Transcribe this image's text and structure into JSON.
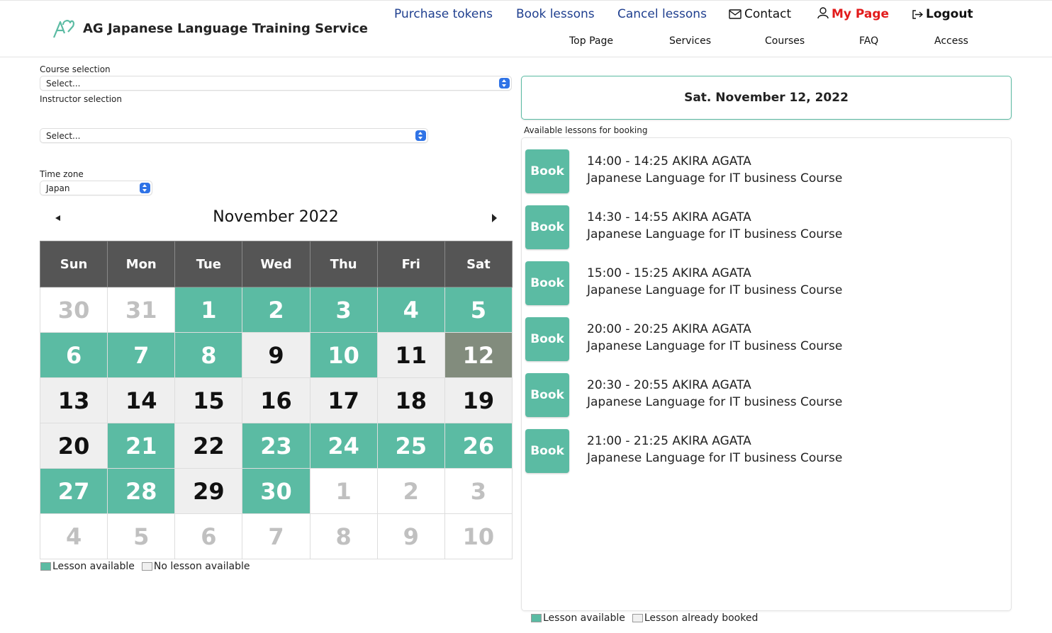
{
  "header": {
    "brand": "AG Japanese Language Training Service",
    "nav_top": [
      {
        "label": "Purchase tokens"
      },
      {
        "label": "Book lessons"
      },
      {
        "label": "Cancel lessons"
      },
      {
        "label": "Contact",
        "icon": "mail-icon"
      },
      {
        "label": "My Page",
        "icon": "user-icon"
      },
      {
        "label": "Logout",
        "icon": "logout-icon"
      }
    ],
    "nav_bottom": [
      {
        "label": "Top Page"
      },
      {
        "label": "Services"
      },
      {
        "label": "Courses"
      },
      {
        "label": "FAQ"
      },
      {
        "label": "Access"
      }
    ]
  },
  "form": {
    "course_label": "Course selection",
    "course_value": "Select...",
    "instructor_label": "Instructor selection",
    "instructor_value": "Select...",
    "timezone_label": "Time zone",
    "timezone_value": "Japan"
  },
  "calendar": {
    "month_title": "November 2022",
    "weekdays": [
      "Sun",
      "Mon",
      "Tue",
      "Wed",
      "Thu",
      "Fri",
      "Sat"
    ],
    "weeks": [
      [
        {
          "d": "30",
          "s": "other"
        },
        {
          "d": "31",
          "s": "other"
        },
        {
          "d": "1",
          "s": "avail"
        },
        {
          "d": "2",
          "s": "avail"
        },
        {
          "d": "3",
          "s": "avail"
        },
        {
          "d": "4",
          "s": "avail"
        },
        {
          "d": "5",
          "s": "avail"
        }
      ],
      [
        {
          "d": "6",
          "s": "avail"
        },
        {
          "d": "7",
          "s": "avail"
        },
        {
          "d": "8",
          "s": "avail"
        },
        {
          "d": "9",
          "s": "none"
        },
        {
          "d": "10",
          "s": "avail"
        },
        {
          "d": "11",
          "s": "none"
        },
        {
          "d": "12",
          "s": "selected"
        }
      ],
      [
        {
          "d": "13",
          "s": "none"
        },
        {
          "d": "14",
          "s": "none"
        },
        {
          "d": "15",
          "s": "none"
        },
        {
          "d": "16",
          "s": "none"
        },
        {
          "d": "17",
          "s": "none"
        },
        {
          "d": "18",
          "s": "none"
        },
        {
          "d": "19",
          "s": "none"
        }
      ],
      [
        {
          "d": "20",
          "s": "none"
        },
        {
          "d": "21",
          "s": "avail"
        },
        {
          "d": "22",
          "s": "none"
        },
        {
          "d": "23",
          "s": "avail"
        },
        {
          "d": "24",
          "s": "avail"
        },
        {
          "d": "25",
          "s": "avail"
        },
        {
          "d": "26",
          "s": "avail"
        }
      ],
      [
        {
          "d": "27",
          "s": "avail"
        },
        {
          "d": "28",
          "s": "avail"
        },
        {
          "d": "29",
          "s": "none"
        },
        {
          "d": "30",
          "s": "avail"
        },
        {
          "d": "1",
          "s": "other"
        },
        {
          "d": "2",
          "s": "other"
        },
        {
          "d": "3",
          "s": "other"
        }
      ],
      [
        {
          "d": "4",
          "s": "other"
        },
        {
          "d": "5",
          "s": "other"
        },
        {
          "d": "6",
          "s": "other"
        },
        {
          "d": "7",
          "s": "other"
        },
        {
          "d": "8",
          "s": "other"
        },
        {
          "d": "9",
          "s": "other"
        },
        {
          "d": "10",
          "s": "other"
        }
      ]
    ],
    "legend_available": "Lesson available",
    "legend_none": "No lesson available",
    "colors": {
      "available": "#5bbba3",
      "selected": "#828c7d",
      "header": "#555555",
      "none": "#efefef"
    }
  },
  "lessons": {
    "selected_date": "Sat. November 12, 2022",
    "list_label": "Available lessons for booking",
    "items": [
      {
        "button": "Book",
        "time": "14:00 - 14:25 AKIRA AGATA",
        "course": "Japanese Language for IT business Course"
      },
      {
        "button": "Book",
        "time": "14:30 - 14:55 AKIRA AGATA",
        "course": "Japanese Language for IT business Course"
      },
      {
        "button": "Book",
        "time": "15:00 - 15:25 AKIRA AGATA",
        "course": "Japanese Language for IT business Course"
      },
      {
        "button": "Book",
        "time": "20:00 - 20:25 AKIRA AGATA",
        "course": "Japanese Language for IT business Course"
      },
      {
        "button": "Book",
        "time": "20:30 - 20:55 AKIRA AGATA",
        "course": "Japanese Language for IT business Course"
      },
      {
        "button": "Book",
        "time": "21:00 - 21:25 AKIRA AGATA",
        "course": "Japanese Language for IT business Course"
      }
    ],
    "legend_available": "Lesson available",
    "legend_booked": "Lesson already booked"
  }
}
